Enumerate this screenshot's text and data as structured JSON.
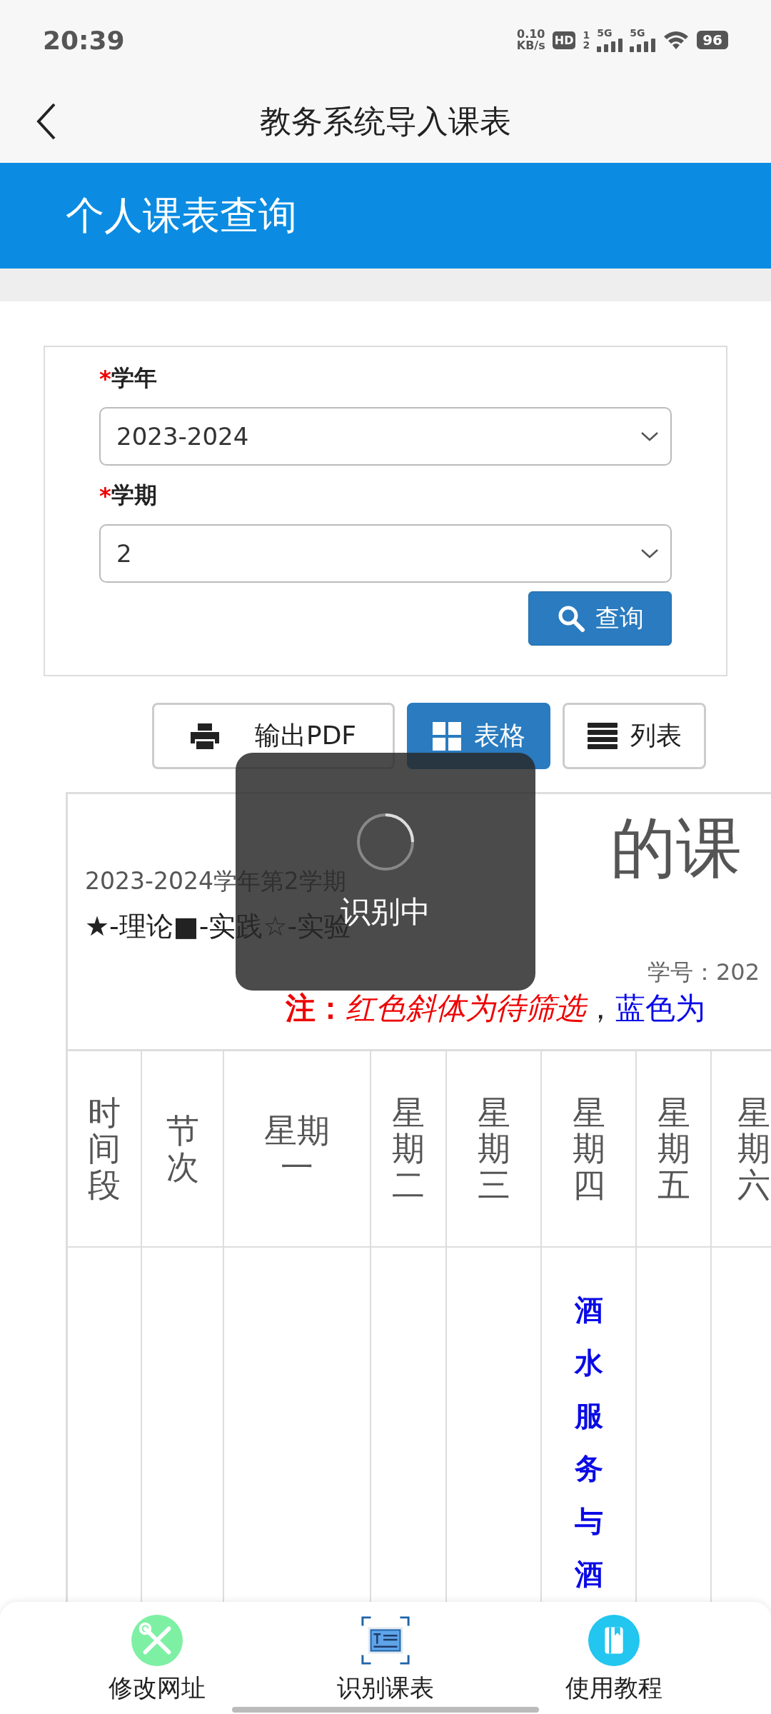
{
  "status_bar": {
    "time": "20:39",
    "net_speed": "0.10",
    "net_unit": "KB/s",
    "hd_badge": "HD",
    "sim_slots": [
      "1",
      "2"
    ],
    "networks": [
      "5G",
      "5G"
    ],
    "battery": "96"
  },
  "app_bar": {
    "title": "教务系统导入课表"
  },
  "banner": {
    "title": "个人课表查询"
  },
  "form": {
    "fields": [
      {
        "marker": "*",
        "label": "学年",
        "value": "2023-2024"
      },
      {
        "marker": "*",
        "label": "学期",
        "value": "2"
      }
    ],
    "query_button": "查询"
  },
  "toolbar": {
    "export_button": "输出PDF",
    "views": [
      {
        "kind": "grid",
        "label": "表格",
        "selected": true
      },
      {
        "kind": "list",
        "label": "列表",
        "selected": false
      }
    ]
  },
  "schedule": {
    "title": "的课",
    "term": "2023-2024学年第2学期",
    "legend": "★-理论■-实践☆-实验",
    "student_id": "学号：202",
    "note": {
      "label": "注：",
      "pending": "红色斜体为待筛选",
      "separator": "，",
      "confirmed": "蓝色为"
    },
    "columns": [
      {
        "header": "时间段"
      },
      {
        "header": "节次"
      },
      {
        "header": "星期一"
      },
      {
        "header": "星期二"
      },
      {
        "header": "星期三"
      },
      {
        "header": "星期四",
        "courses": [
          "酒水服务与酒"
        ]
      },
      {
        "header": "星期五"
      },
      {
        "header": "星期六"
      }
    ]
  },
  "toast": {
    "text": "识别中"
  },
  "bottom_nav": [
    {
      "kind": "edit",
      "label": "修改网址"
    },
    {
      "kind": "scan",
      "label": "识别课表"
    },
    {
      "kind": "guide",
      "label": "使用教程"
    }
  ]
}
